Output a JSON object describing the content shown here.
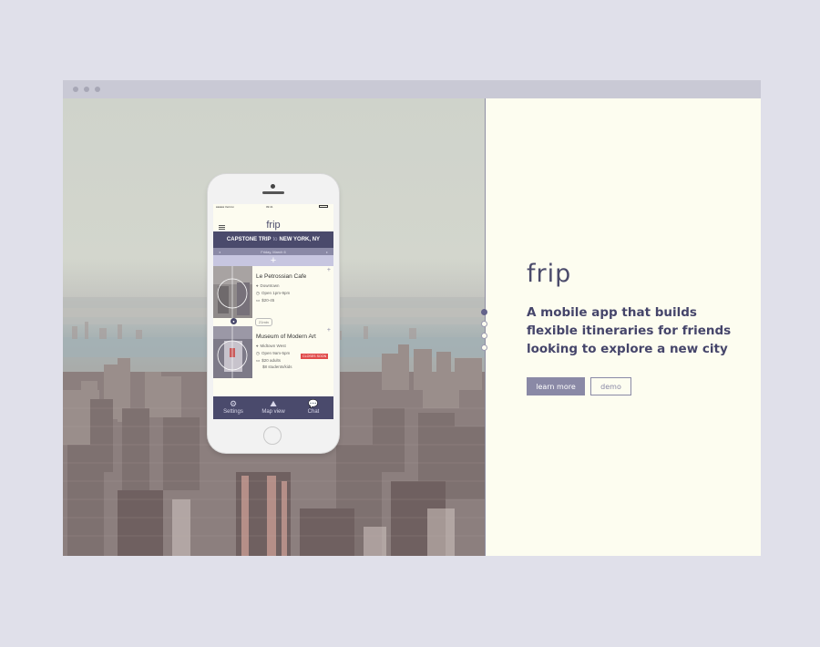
{
  "browser": {
    "controls": [
      "close-dot",
      "minimize-dot",
      "maximize-dot"
    ]
  },
  "brand": {
    "name": "frip"
  },
  "tagline": "A mobile app that builds flexible itineraries for friends looking to explore a new city",
  "buttons": {
    "learn_more": "learn more",
    "demo": "demo"
  },
  "slide_nav": {
    "count": 4,
    "active_index": 0
  },
  "phone": {
    "status": {
      "carrier": "●●●●● Verizon",
      "time": "09:41"
    },
    "app_title": "frip",
    "trip": {
      "name": "CAPSTONE TRIP",
      "connector": "to",
      "city": "NEW YORK, NY"
    },
    "date": {
      "label": "Friday, March 6"
    },
    "add_symbol": "+",
    "places": [
      {
        "name": "Le Petrossian Cafe",
        "area": "Downtown",
        "hours": "Open 1pm-9pm",
        "price": "$20-45"
      },
      {
        "name": "Museum of Modern Art",
        "area": "Midtown West",
        "hours": "Open 9am-5pm",
        "price": "$20 adults",
        "price_extra": "$8 students/kids",
        "badge": "CLOSES SOON"
      }
    ],
    "travel_time": "21min",
    "tabs": [
      {
        "label": "Settings",
        "icon": "gear-icon"
      },
      {
        "label": "Map view",
        "icon": "map-icon"
      },
      {
        "label": "Chat",
        "icon": "chat-icon"
      }
    ]
  },
  "colors": {
    "accent": "#4a4a6c",
    "accent_light": "#8a89a6",
    "panel_bg": "#fdfdf0",
    "badge_red": "#e14b4b"
  }
}
